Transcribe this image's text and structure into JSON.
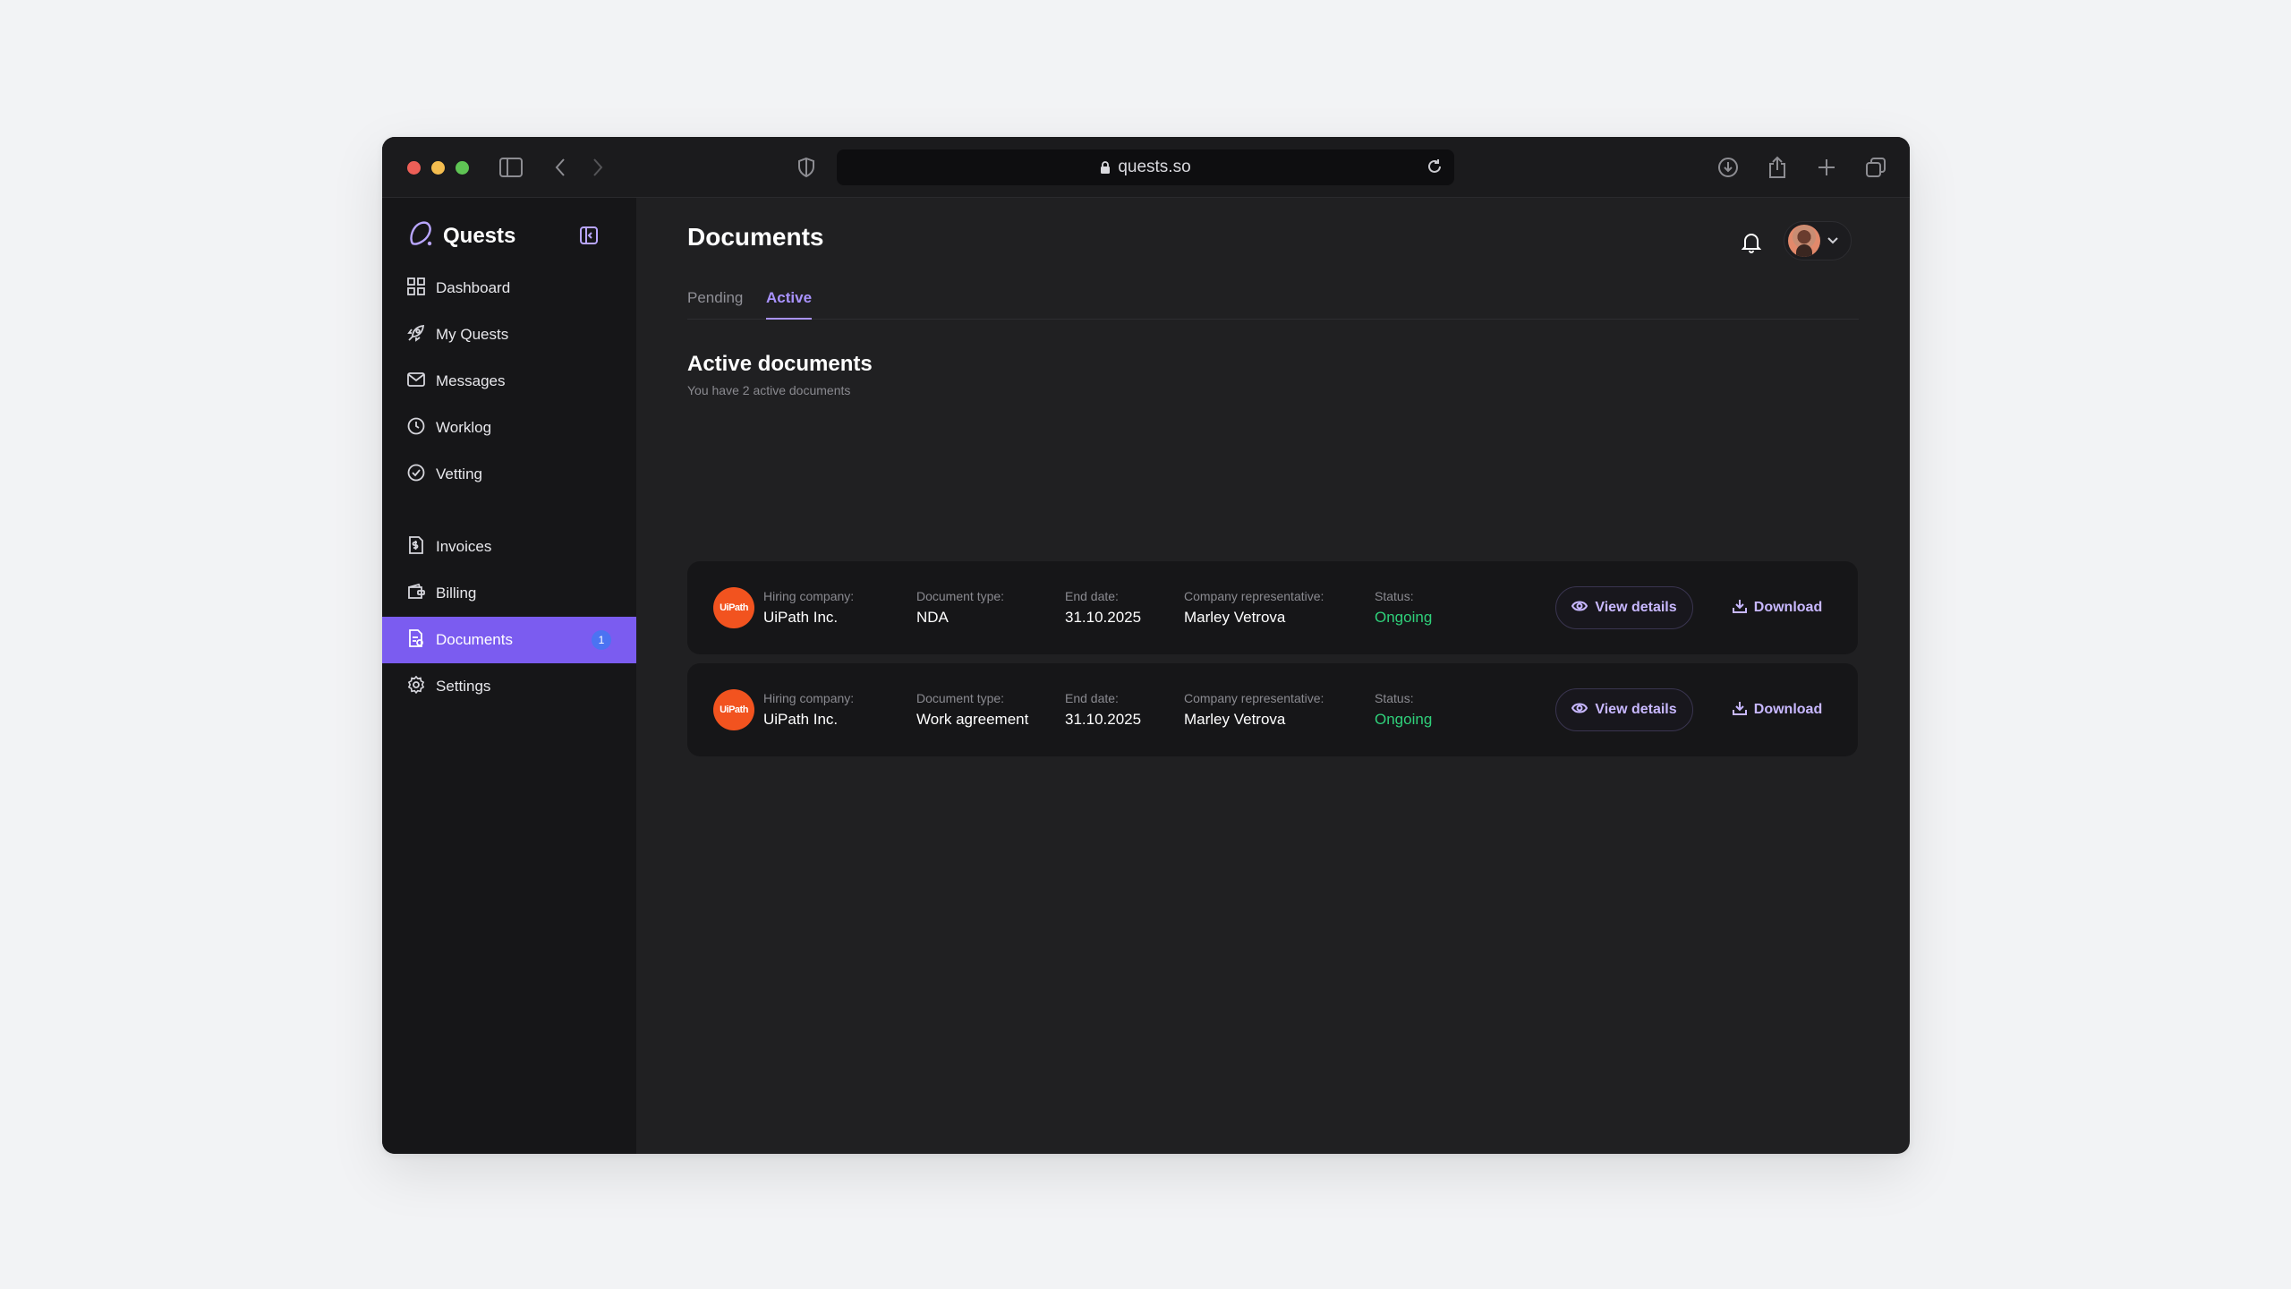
{
  "browser": {
    "url": "quests.so"
  },
  "sidebar": {
    "brand": "Quests",
    "items": [
      {
        "label": "Dashboard",
        "icon": "grid-icon"
      },
      {
        "label": "My Quests",
        "icon": "rocket-icon"
      },
      {
        "label": "Messages",
        "icon": "mail-icon"
      },
      {
        "label": "Worklog",
        "icon": "clock-icon"
      },
      {
        "label": "Vetting",
        "icon": "check-circle-icon"
      },
      {
        "label": "Invoices",
        "icon": "invoice-icon"
      },
      {
        "label": "Billing",
        "icon": "wallet-icon"
      },
      {
        "label": "Documents",
        "icon": "document-icon",
        "active": true,
        "badge": "1"
      },
      {
        "label": "Settings",
        "icon": "gear-icon"
      }
    ]
  },
  "header": {
    "title": "Documents"
  },
  "tabs": [
    {
      "label": "Pending"
    },
    {
      "label": "Active",
      "active": true
    }
  ],
  "section": {
    "title": "Active documents",
    "subtitle": "You have 2 active documents"
  },
  "documents": [
    {
      "logo_text": "UiPath",
      "company_label": "Hiring company:",
      "company": "UiPath Inc.",
      "type_label": "Document type:",
      "type": "NDA",
      "end_label": "End date:",
      "end_date": "31.10.2025",
      "rep_label": "Company representative:",
      "rep": "Marley Vetrova",
      "status_label": "Status:",
      "status": "Ongoing",
      "view_label": "View details",
      "download_label": "Download"
    },
    {
      "logo_text": "UiPath",
      "company_label": "Hiring company:",
      "company": "UiPath Inc.",
      "type_label": "Document type:",
      "type": "Work agreement",
      "end_label": "End date:",
      "end_date": "31.10.2025",
      "rep_label": "Company representative:",
      "rep": "Marley Vetrova",
      "status_label": "Status:",
      "status": "Ongoing",
      "view_label": "View details",
      "download_label": "Download"
    }
  ],
  "colors": {
    "accent": "#7b5cf0",
    "status_ok": "#2fd07a",
    "logo": "#f2531f"
  }
}
